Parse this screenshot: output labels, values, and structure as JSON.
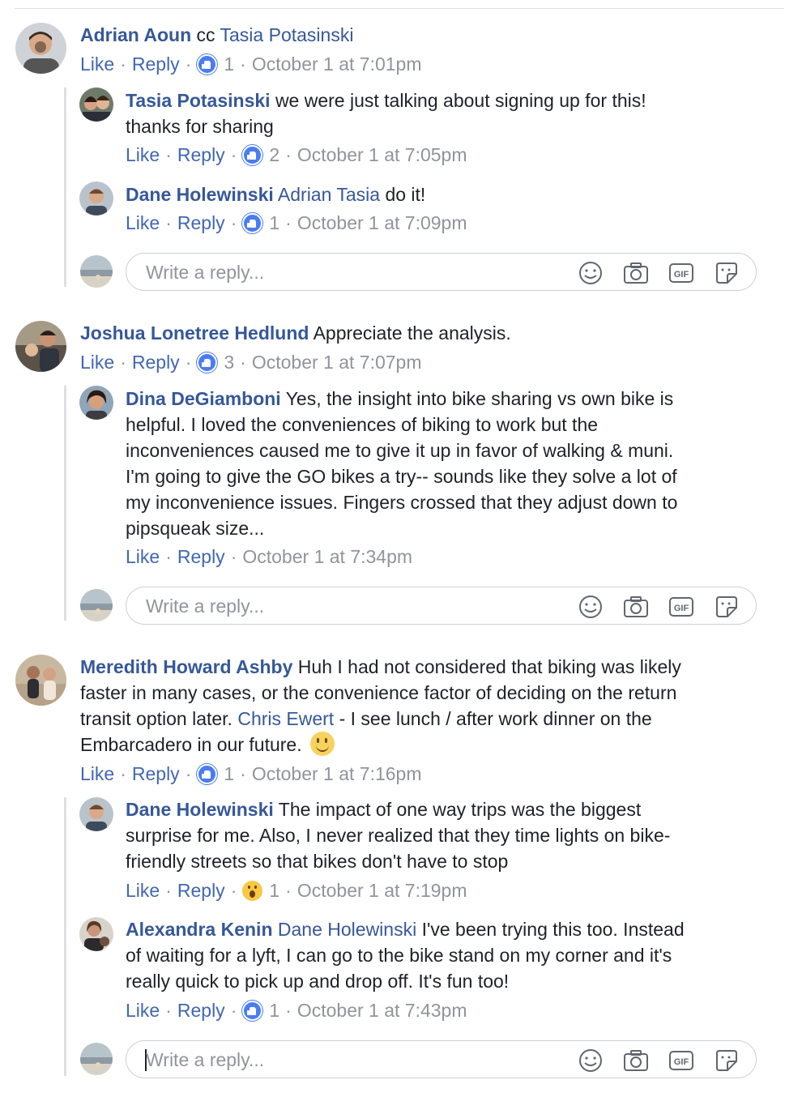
{
  "actions": {
    "like": "Like",
    "reply": "Reply",
    "dot": "·"
  },
  "reply_placeholder": "Write a reply...",
  "comments": {
    "c1": {
      "author": "Adrian Aoun",
      "text_pre": "cc",
      "tag": "Tasia Potasinski",
      "reaction_count": "1",
      "time": "October 1 at 7:01pm",
      "replies": {
        "r1": {
          "author": "Tasia Potasinski",
          "line1": "we were just talking about signing up for this!",
          "line2": "thanks for sharing",
          "reaction_count": "2",
          "time": "October 1 at 7:05pm"
        },
        "r2": {
          "author": "Dane Holewinski",
          "tag": "Adrian Tasia",
          "text": "do it!",
          "reaction_count": "1",
          "time": "October 1 at 7:09pm"
        }
      }
    },
    "c2": {
      "author": "Joshua Lonetree Hedlund",
      "text": "Appreciate the analysis.",
      "reaction_count": "3",
      "time": "October 1 at 7:07pm",
      "replies": {
        "r1": {
          "author": "Dina DeGiamboni",
          "line1": "Yes, the insight into bike sharing vs own bike is",
          "line2": "helpful. I loved the conveniences of biking to work but the",
          "line3": "inconveniences caused me to give it up in favor of walking & muni.",
          "line4": "I'm going to give the GO bikes a try-- sounds like they solve a lot of",
          "line5": "my inconvenience issues. Fingers crossed that they adjust down to",
          "line6": "pipsqueak size...",
          "time": "October 1 at 7:34pm"
        }
      }
    },
    "c3": {
      "author": "Meredith Howard Ashby",
      "line1": "Huh I had not considered that biking was likely",
      "line2": "faster in many cases, or the convenience factor of deciding on the return",
      "line3a": "transit option later.",
      "tag": "Chris Ewert",
      "line3b": "- I see lunch / after work dinner on the",
      "line4": "Embarcadero in our future.",
      "reaction_count": "1",
      "time": "October 1 at 7:16pm",
      "replies": {
        "r1": {
          "author": "Dane Holewinski",
          "line1": "The impact of one way trips was the biggest",
          "line2": "surprise for me. Also, I never realized that they time lights on bike-",
          "line3": "friendly streets so that bikes don't have to stop",
          "reaction_count": "1",
          "time": "October 1 at 7:19pm"
        },
        "r2": {
          "author": "Alexandra Kenin",
          "tag": "Dane Holewinski",
          "line1": "I've been trying this too. Instead",
          "line2": "of waiting for a lyft, I can go to the bike stand on my corner and it's",
          "line3": "really quick to pick up and drop off. It's fun too!",
          "reaction_count": "1",
          "time": "October 1 at 7:43pm"
        }
      }
    }
  }
}
